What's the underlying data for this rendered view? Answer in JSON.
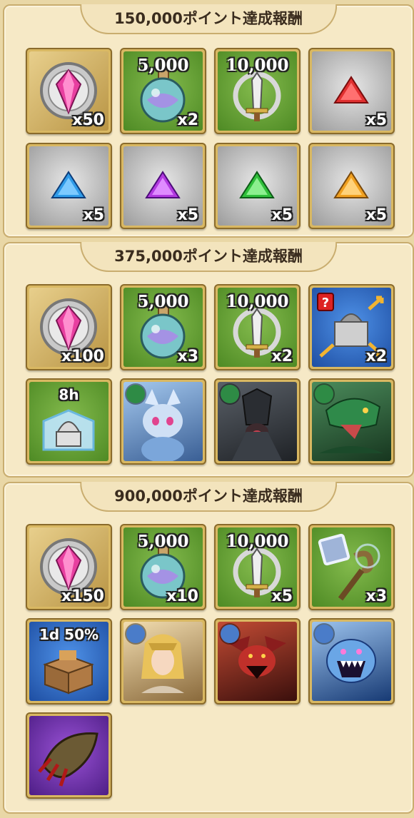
{
  "sections": [
    {
      "title": "150,000ポイント達成報酬",
      "items": [
        {
          "icon": "gem-compass-icon",
          "qty": "x50",
          "top": ""
        },
        {
          "icon": "potion-icon",
          "qty": "x2",
          "top": "5,000"
        },
        {
          "icon": "sword-emblem-icon",
          "qty": "",
          "top": "10,000"
        },
        {
          "icon": "red-triangle-gem-icon",
          "qty": "x5",
          "top": ""
        },
        {
          "icon": "blue-triangle-gem-icon",
          "qty": "x5",
          "top": ""
        },
        {
          "icon": "purple-triangle-gem-icon",
          "qty": "x5",
          "top": ""
        },
        {
          "icon": "green-triangle-gem-icon",
          "qty": "x5",
          "top": ""
        },
        {
          "icon": "orange-triangle-gem-icon",
          "qty": "x5",
          "top": ""
        }
      ]
    },
    {
      "title": "375,000ポイント達成報酬",
      "items": [
        {
          "icon": "gem-compass-icon",
          "qty": "x100",
          "top": ""
        },
        {
          "icon": "potion-icon",
          "qty": "x3",
          "top": "5,000"
        },
        {
          "icon": "sword-emblem-icon",
          "qty": "x2",
          "top": "10,000"
        },
        {
          "icon": "castle-relocate-icon",
          "qty": "x2",
          "top": ""
        },
        {
          "icon": "barrier-shield-icon",
          "qty": "",
          "top": "8h"
        },
        {
          "icon": "monster-card-fox-icon",
          "qty": "",
          "top": ""
        },
        {
          "icon": "monster-card-dark-knight-icon",
          "qty": "",
          "top": ""
        },
        {
          "icon": "monster-card-green-dragon-icon",
          "qty": "",
          "top": ""
        }
      ]
    },
    {
      "title": "900,000ポイント達成報酬",
      "items": [
        {
          "icon": "gem-compass-icon",
          "qty": "x150",
          "top": ""
        },
        {
          "icon": "potion-icon",
          "qty": "x10",
          "top": "5,000"
        },
        {
          "icon": "sword-emblem-icon",
          "qty": "x5",
          "top": "10,000"
        },
        {
          "icon": "scroll-staff-icon",
          "qty": "x3",
          "top": ""
        },
        {
          "icon": "resource-crate-icon",
          "qty": "",
          "top": "1d 50%"
        },
        {
          "icon": "monster-card-valkyrie-icon",
          "qty": "",
          "top": ""
        },
        {
          "icon": "monster-card-red-dragon-icon",
          "qty": "",
          "top": ""
        },
        {
          "icon": "monster-card-ice-beast-icon",
          "qty": "",
          "top": ""
        },
        {
          "icon": "claw-frame-icon",
          "qty": "",
          "top": ""
        }
      ]
    }
  ]
}
